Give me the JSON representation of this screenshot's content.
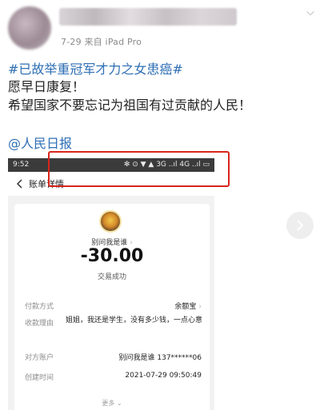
{
  "post": {
    "meta": "7-29 来自 iPad Pro",
    "lines": {
      "hashtag": "#已故举重冠军才力之女患癌#",
      "line1": "愿早日康复！",
      "line2": "希望国家不要忘记为祖国有过贡献的人民！",
      "mention": "@人民日报"
    }
  },
  "screenshot": {
    "status": {
      "time": "9:52",
      "icons": "✻ ⊙ ▼ ▲ 3G ..ıl 4G ..ıl ▭"
    },
    "nav_title": "账单详情",
    "payee_name": "别问我是谁",
    "amount": "-30.00",
    "trade_status": "交易成功",
    "rows": {
      "payment_label": "付款方式",
      "payment_value": "余额宝",
      "memo_label": "收款理由",
      "memo_value": "姐姐，我还是学生，没有多少钱，一点心意",
      "counterparty_label": "对方账户",
      "counterparty_value": "别问我是谁 137******06",
      "created_label": "创建时间",
      "created_value": "2021-07-29 09:50:49"
    },
    "more_label": "更多"
  },
  "colors": {
    "link": "#2f6fb5",
    "highlight": "#d9251c"
  },
  "icons": [
    "back-arrow-icon",
    "chevron-right-icon",
    "chevron-down-icon",
    "next-arrow-icon"
  ]
}
